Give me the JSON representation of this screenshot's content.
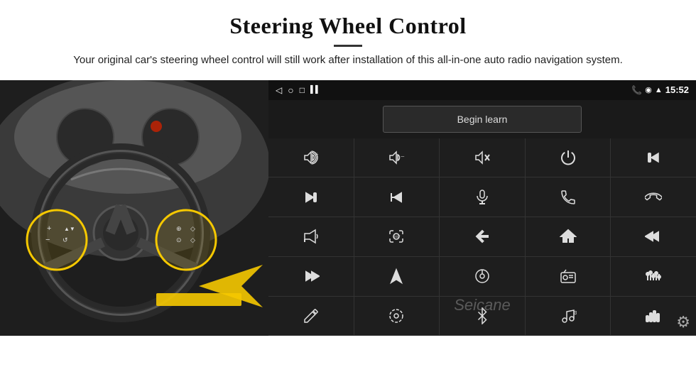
{
  "header": {
    "title": "Steering Wheel Control",
    "subtitle": "Your original car's steering wheel control will still work after installation of this all-in-one auto radio navigation system."
  },
  "screen": {
    "status_bar": {
      "time": "15:52",
      "nav_back": "◁",
      "nav_home": "○",
      "nav_recent": "□",
      "signal_icons": "▌▌ ▲ ♥"
    },
    "begin_learn_label": "Begin learn",
    "icons": [
      {
        "id": "vol-up",
        "label": "Volume Up"
      },
      {
        "id": "vol-down",
        "label": "Volume Down"
      },
      {
        "id": "mute",
        "label": "Mute"
      },
      {
        "id": "power",
        "label": "Power"
      },
      {
        "id": "prev-track",
        "label": "Previous Track"
      },
      {
        "id": "skip-forward",
        "label": "Skip Forward"
      },
      {
        "id": "skip-back-x",
        "label": "Skip Back"
      },
      {
        "id": "mic",
        "label": "Microphone"
      },
      {
        "id": "call",
        "label": "Call"
      },
      {
        "id": "hang-up",
        "label": "Hang Up"
      },
      {
        "id": "horn",
        "label": "Horn/Speaker"
      },
      {
        "id": "360",
        "label": "360 Camera"
      },
      {
        "id": "back",
        "label": "Back"
      },
      {
        "id": "home",
        "label": "Home"
      },
      {
        "id": "prev-chapter",
        "label": "Previous Chapter"
      },
      {
        "id": "next-track",
        "label": "Next Track"
      },
      {
        "id": "navigation",
        "label": "Navigation"
      },
      {
        "id": "eject",
        "label": "Eject"
      },
      {
        "id": "radio",
        "label": "Radio"
      },
      {
        "id": "equalizer",
        "label": "Equalizer"
      },
      {
        "id": "pen",
        "label": "Pen/Write"
      },
      {
        "id": "settings2",
        "label": "Settings"
      },
      {
        "id": "bluetooth",
        "label": "Bluetooth"
      },
      {
        "id": "music",
        "label": "Music"
      },
      {
        "id": "sound-bars",
        "label": "Sound Bars"
      }
    ],
    "watermark": "Seicane",
    "settings_label": "⚙"
  }
}
